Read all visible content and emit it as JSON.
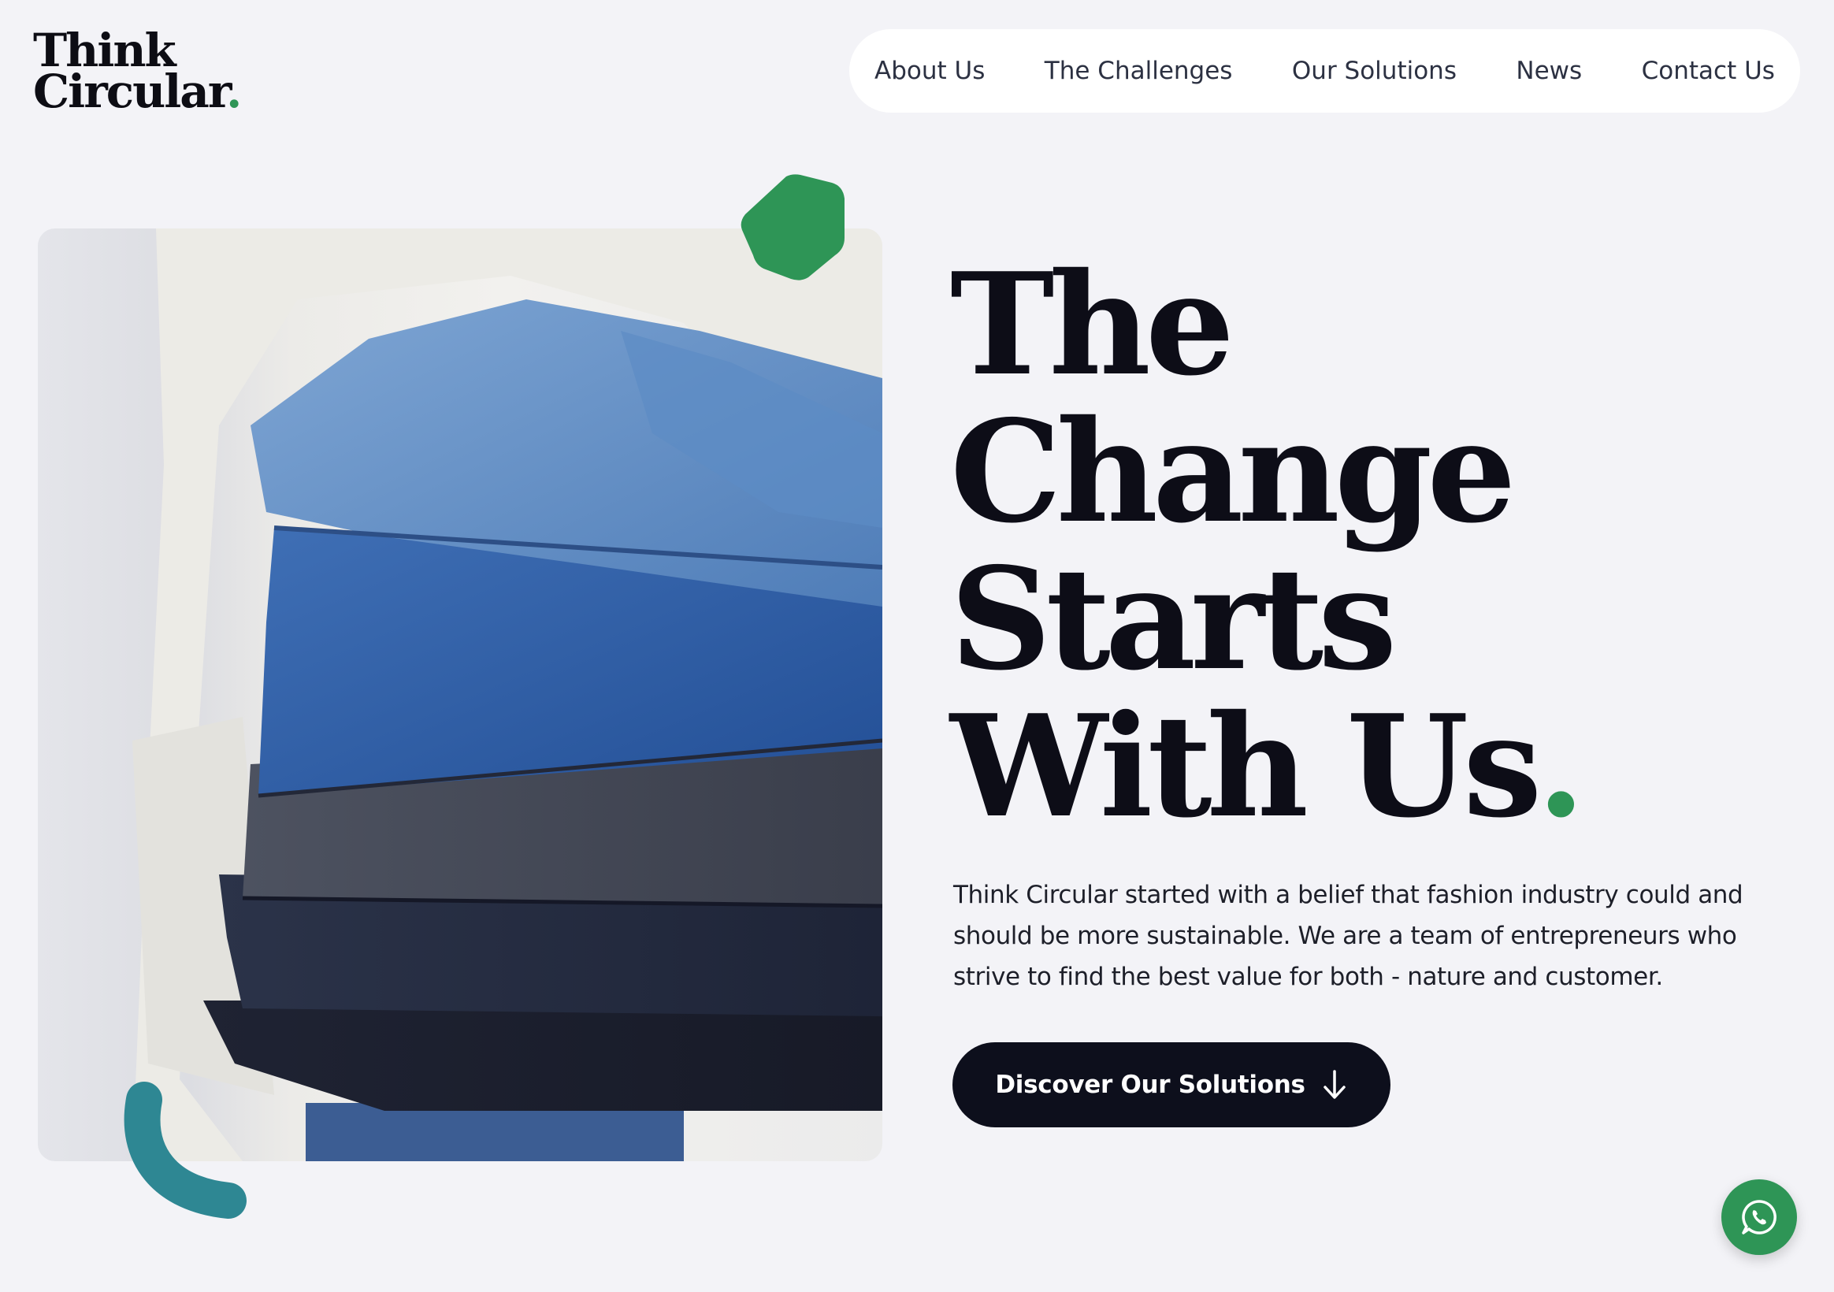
{
  "logo": {
    "line1": "Think",
    "line2": "Circular",
    "dot": "."
  },
  "nav": {
    "items": [
      {
        "label": "About Us"
      },
      {
        "label": "The Challenges"
      },
      {
        "label": "Our Solutions"
      },
      {
        "label": "News"
      },
      {
        "label": "Contact Us"
      }
    ]
  },
  "hero": {
    "headline_lines": [
      "The",
      "Change",
      "Starts",
      "With Us"
    ],
    "headline_dot": ".",
    "intro": "Think Circular started with a belief that fashion industry could and should be more sustainable. We are a team of entrepreneurs who strive to find the best value for both - nature and customer.",
    "cta_label": "Discover Our Solutions",
    "cta_icon": "arrow-down-icon"
  },
  "fab": {
    "icon": "whatsapp-icon"
  },
  "colors": {
    "accent_green": "#2e9556",
    "teal": "#2e8793",
    "dark": "#0d0f1c",
    "background": "#f3f3f7"
  }
}
